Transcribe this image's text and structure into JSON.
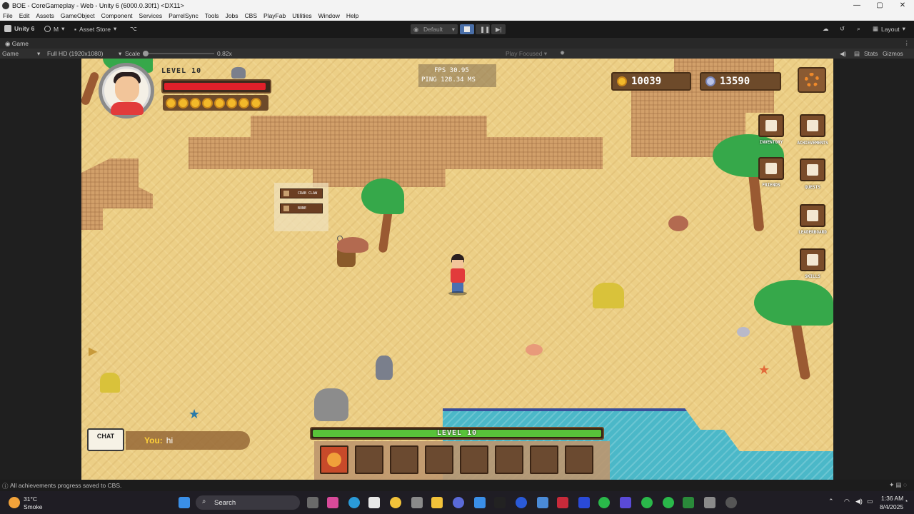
{
  "window": {
    "title": "BOE - CoreGameplay - Web - Unity 6 (6000.0.30f1) <DX11>",
    "buttons": [
      "—",
      "▢",
      "✕"
    ]
  },
  "menu": [
    "File",
    "Edit",
    "Assets",
    "GameObject",
    "Component",
    "Services",
    "ParrelSync",
    "Tools",
    "Jobs",
    "CBS",
    "PlayFab",
    "Utilities",
    "Window",
    "Help"
  ],
  "toolbar": {
    "account": "Unity 6",
    "user": "M",
    "asset_store": "Asset Store",
    "mode_dropdown": "Default",
    "layout": "Layout"
  },
  "game_tab": {
    "label": "Game",
    "display": "Game",
    "resolution": "Full HD (1920x1080)",
    "scale_label": "Scale",
    "scale_value": "0.82x",
    "play_mode": "Play Focused",
    "stats": "Stats",
    "gizmos": "Gizmos"
  },
  "hud": {
    "level": "LEVEL 10",
    "hp_fraction": 0.97,
    "fps_line": "FPS  30.95",
    "ping_line": "PING  128.34  MS",
    "gold": "10039",
    "gems": "13590",
    "side_buttons": [
      {
        "label": "INVENTORY",
        "icon": "inventory-icon"
      },
      {
        "label": "ACHIEVEMENTS",
        "icon": "crown-icon"
      },
      {
        "label": "FRIENDS",
        "icon": "friends-icon"
      },
      {
        "label": "QUESTS",
        "icon": "quests-icon"
      },
      {
        "label": "LEADERBOARD",
        "icon": "leaderboard-icon"
      },
      {
        "label": "SKILLS",
        "icon": "skills-icon"
      }
    ],
    "context_menu": [
      "CRAB CLAW",
      "BONE"
    ],
    "xp_level": "LEVEL 10",
    "xp_fraction": 1.0,
    "chat_label": "CHAT",
    "chat_speaker": "You:",
    "chat_message": "hi"
  },
  "status": {
    "message": "All achievements progress saved to CBS."
  },
  "taskbar": {
    "weather_temp": "31°C",
    "weather_desc": "Smoke",
    "search_placeholder": "Search",
    "time": "1:36 AM",
    "date": "8/4/2025"
  },
  "colors": {
    "sand": "#eccf86",
    "dirt": "#d2a06a",
    "water": "#4bb8c8",
    "hp": "#e0202a",
    "xp": "#58c23a"
  }
}
